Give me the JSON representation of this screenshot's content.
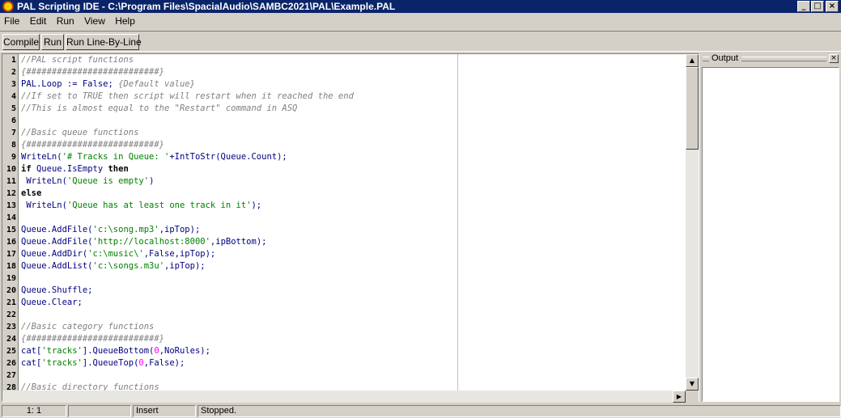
{
  "window": {
    "title": "PAL Scripting IDE - C:\\Program Files\\SpacialAudio\\SAMBC2021\\PAL\\Example.PAL",
    "minimize_glyph": "_",
    "maximize_glyph": "□",
    "close_glyph": "×"
  },
  "menu": [
    "File",
    "Edit",
    "Run",
    "View",
    "Help"
  ],
  "toolbar": {
    "compile": "Compile",
    "run": "Run",
    "run_line": "Run Line-By-Line"
  },
  "editor": {
    "line_numbers": [
      "1",
      "2",
      "3",
      "4",
      "5",
      "6",
      "7",
      "8",
      "9",
      "10",
      "11",
      "12",
      "13",
      "14",
      "15",
      "16",
      "17",
      "18",
      "19",
      "20",
      "21",
      "22",
      "23",
      "24",
      "25",
      "26",
      "27",
      "28"
    ],
    "lines": [
      [
        {
          "t": "//PAL script functions",
          "c": "c"
        }
      ],
      [
        {
          "t": "{##########################}",
          "c": "c"
        }
      ],
      [
        {
          "t": "PAL.Loop := False; ",
          "c": "i"
        },
        {
          "t": "{Default value}",
          "c": "c"
        }
      ],
      [
        {
          "t": "//If set to TRUE then script will restart when it reached the end",
          "c": "c"
        }
      ],
      [
        {
          "t": "//This is almost equal to the \"Restart\" command in ASQ",
          "c": "c"
        }
      ],
      [],
      [
        {
          "t": "//Basic queue functions",
          "c": "c"
        }
      ],
      [
        {
          "t": "{##########################}",
          "c": "c"
        }
      ],
      [
        {
          "t": "WriteLn(",
          "c": "i"
        },
        {
          "t": "'# Tracks in Queue: '",
          "c": "s"
        },
        {
          "t": "+IntToStr(Queue.Count);",
          "c": "i"
        }
      ],
      [
        {
          "t": "if",
          "c": "k"
        },
        {
          "t": " Queue.IsEmpty ",
          "c": "i"
        },
        {
          "t": "then",
          "c": "k"
        }
      ],
      [
        {
          "t": " WriteLn(",
          "c": "i"
        },
        {
          "t": "'Queue is empty'",
          "c": "s"
        },
        {
          "t": ")",
          "c": "i"
        }
      ],
      [
        {
          "t": "else",
          "c": "k"
        }
      ],
      [
        {
          "t": " WriteLn(",
          "c": "i"
        },
        {
          "t": "'Queue has at least one track in it'",
          "c": "s"
        },
        {
          "t": ");",
          "c": "i"
        }
      ],
      [],
      [
        {
          "t": "Queue.AddFile(",
          "c": "i"
        },
        {
          "t": "'c:\\song.mp3'",
          "c": "s"
        },
        {
          "t": ",ipTop);",
          "c": "i"
        }
      ],
      [
        {
          "t": "Queue.AddFile(",
          "c": "i"
        },
        {
          "t": "'http://localhost:8000'",
          "c": "s"
        },
        {
          "t": ",ipBottom);",
          "c": "i"
        }
      ],
      [
        {
          "t": "Queue.AddDir(",
          "c": "i"
        },
        {
          "t": "'c:\\music\\'",
          "c": "s"
        },
        {
          "t": ",False,ipTop);",
          "c": "i"
        }
      ],
      [
        {
          "t": "Queue.AddList(",
          "c": "i"
        },
        {
          "t": "'c:\\songs.m3u'",
          "c": "s"
        },
        {
          "t": ",ipTop);",
          "c": "i"
        }
      ],
      [],
      [
        {
          "t": "Queue.Shuffle;",
          "c": "i"
        }
      ],
      [
        {
          "t": "Queue.Clear;",
          "c": "i"
        }
      ],
      [],
      [
        {
          "t": "//Basic category functions",
          "c": "c"
        }
      ],
      [
        {
          "t": "{##########################}",
          "c": "c"
        }
      ],
      [
        {
          "t": "cat[",
          "c": "i"
        },
        {
          "t": "'tracks'",
          "c": "s"
        },
        {
          "t": "].QueueBottom(",
          "c": "i"
        },
        {
          "t": "0",
          "c": "n"
        },
        {
          "t": ",NoRules);",
          "c": "i"
        }
      ],
      [
        {
          "t": "cat[",
          "c": "i"
        },
        {
          "t": "'tracks'",
          "c": "s"
        },
        {
          "t": "].QueueTop(",
          "c": "i"
        },
        {
          "t": "0",
          "c": "n"
        },
        {
          "t": ",False);",
          "c": "i"
        }
      ],
      [],
      [
        {
          "t": "//Basic directory functions",
          "c": "c"
        }
      ]
    ]
  },
  "output": {
    "title": "Output",
    "close_glyph": "×"
  },
  "scroll": {
    "up": "▲",
    "down": "▼",
    "left": "◀",
    "right": "▶"
  },
  "status": {
    "position": "1:  1",
    "mode": "Insert",
    "state": "Stopped."
  }
}
